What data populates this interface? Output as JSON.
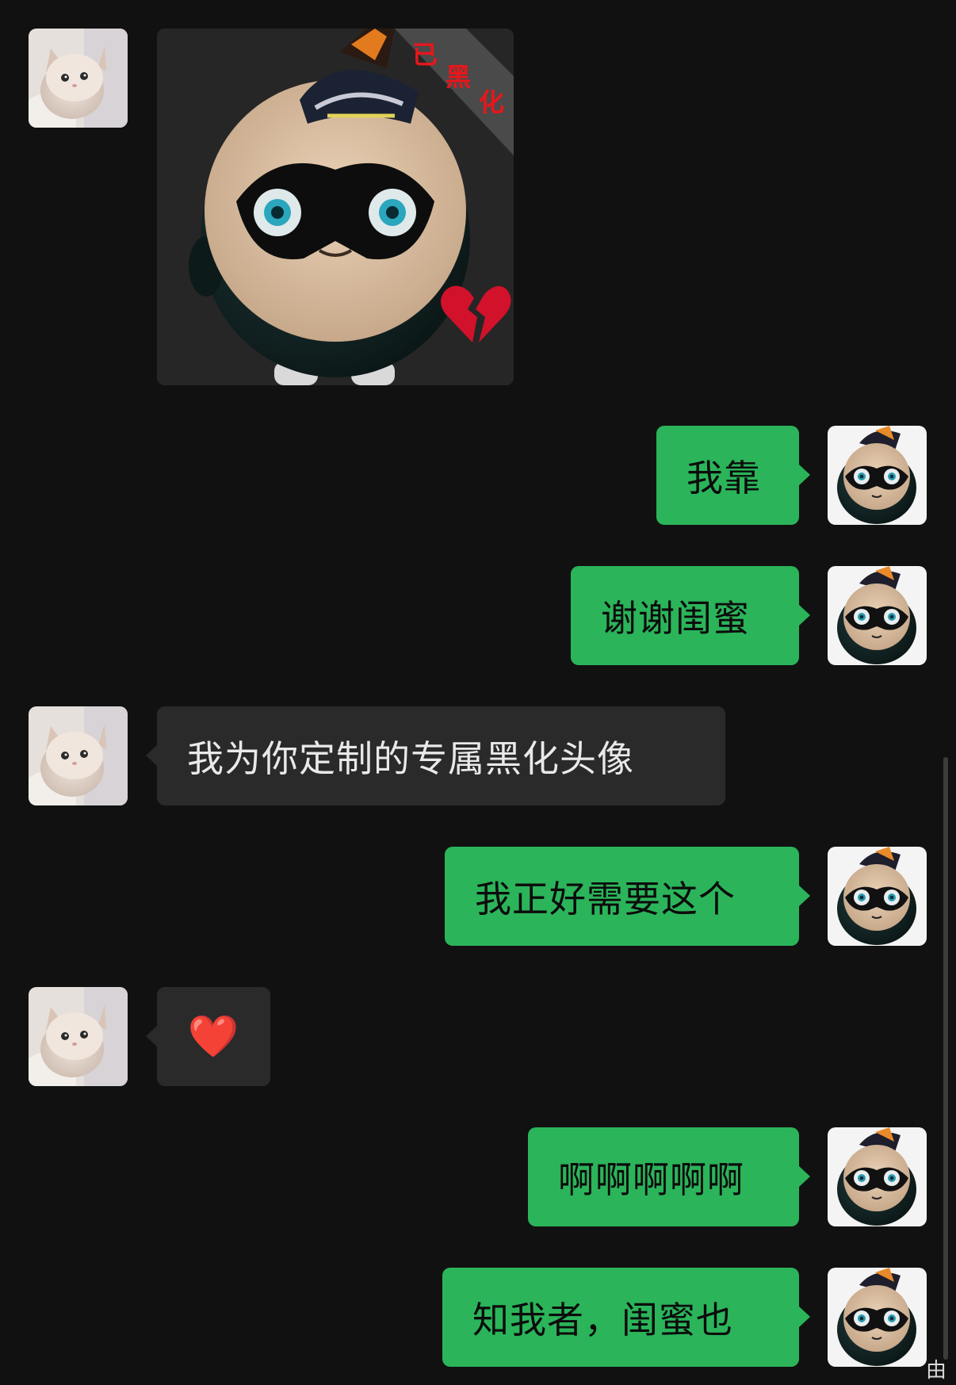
{
  "colors": {
    "background": "#111111",
    "outgoing_bubble": "#2bb45a",
    "incoming_bubble": "#2a2a2a",
    "stamp_red": "#e8161b"
  },
  "sticker": {
    "icon": "masked-mascot-sticker",
    "stamp_chars": [
      "已",
      "黑",
      "化"
    ],
    "badge_icon": "broken-heart-icon"
  },
  "messages": [
    {
      "side": "left",
      "type": "sticker"
    },
    {
      "side": "right",
      "text": "我靠"
    },
    {
      "side": "right",
      "text": "谢谢闺蜜"
    },
    {
      "side": "left",
      "text": "我为你定制的专属黑化头像"
    },
    {
      "side": "right",
      "text": "我正好需要这个"
    },
    {
      "side": "left",
      "text": "❤️",
      "icon": "red-heart-icon"
    },
    {
      "side": "right",
      "text": "啊啊啊啊啊"
    },
    {
      "side": "right",
      "text": "知我者，闺蜜也"
    }
  ],
  "avatars": {
    "incoming": "kitten-avatar-icon",
    "outgoing": "masked-mascot-avatar-icon"
  },
  "corner_text": "由"
}
